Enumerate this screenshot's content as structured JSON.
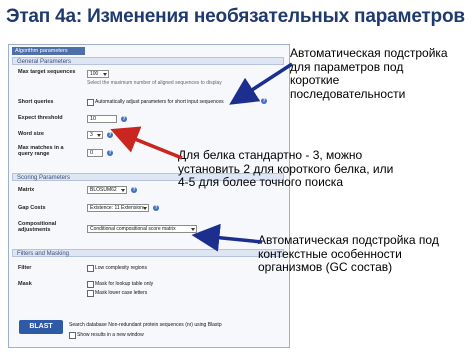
{
  "title": "Этап 4а: Изменения необязательных параметров",
  "screenshot": {
    "algorithm_tab": "Algorithm parameters",
    "general_header": "General Parameters",
    "max_target_label": "Max target sequences",
    "max_target_value": "100",
    "max_target_hint": "Select the maximum number of aligned sequences to display",
    "short_queries_label": "Short queries",
    "short_queries_option": "Automatically adjust parameters for short input sequences",
    "expect_label": "Expect threshold",
    "expect_value": "10",
    "word_size_label": "Word size",
    "word_size_value": "3",
    "max_matches_label": "Max matches in a query range",
    "max_matches_value": "0",
    "scoring_header": "Scoring Parameters",
    "matrix_label": "Matrix",
    "matrix_value": "BLOSUM62",
    "gap_costs_label": "Gap Costs",
    "gap_costs_value": "Existence: 11 Extension: 1",
    "comp_adj_label": "Compositional adjustments",
    "comp_adj_value": "Conditional compositional score matrix adjustment",
    "filters_header": "Filters and Masking",
    "filter_label": "Filter",
    "filter_option": "Low complexity regions",
    "mask_label": "Mask",
    "mask_option1": "Mask for lookup table only",
    "mask_option2": "Mask lower case letters",
    "blast_button": "BLAST",
    "search_text": "Search database Non-redundant protein sequences (nr) using Blastp",
    "new_window_text": "Show results in a new window"
  },
  "annotations": {
    "note1_line1": "Автоматическая подстройка",
    "note1_line2": "для параметров под",
    "note1_line3": "короткие",
    "note1_line4": "последовательности",
    "note2_line1": "Для белка стандартно - 3, можно",
    "note2_line2": "установить 2 для короткого белка, или",
    "note2_line3": "4-5 для более точного поиска",
    "note3_line1": "Автоматическая подстройка под",
    "note3_line2": "контекстные особенности",
    "note3_line3": "организмов (GC состав)"
  },
  "colors": {
    "title": "#1f3a6e",
    "arrow_blue": "#1c2f8f",
    "arrow_red": "#c8261e",
    "blast_button": "#2e5aa8"
  }
}
